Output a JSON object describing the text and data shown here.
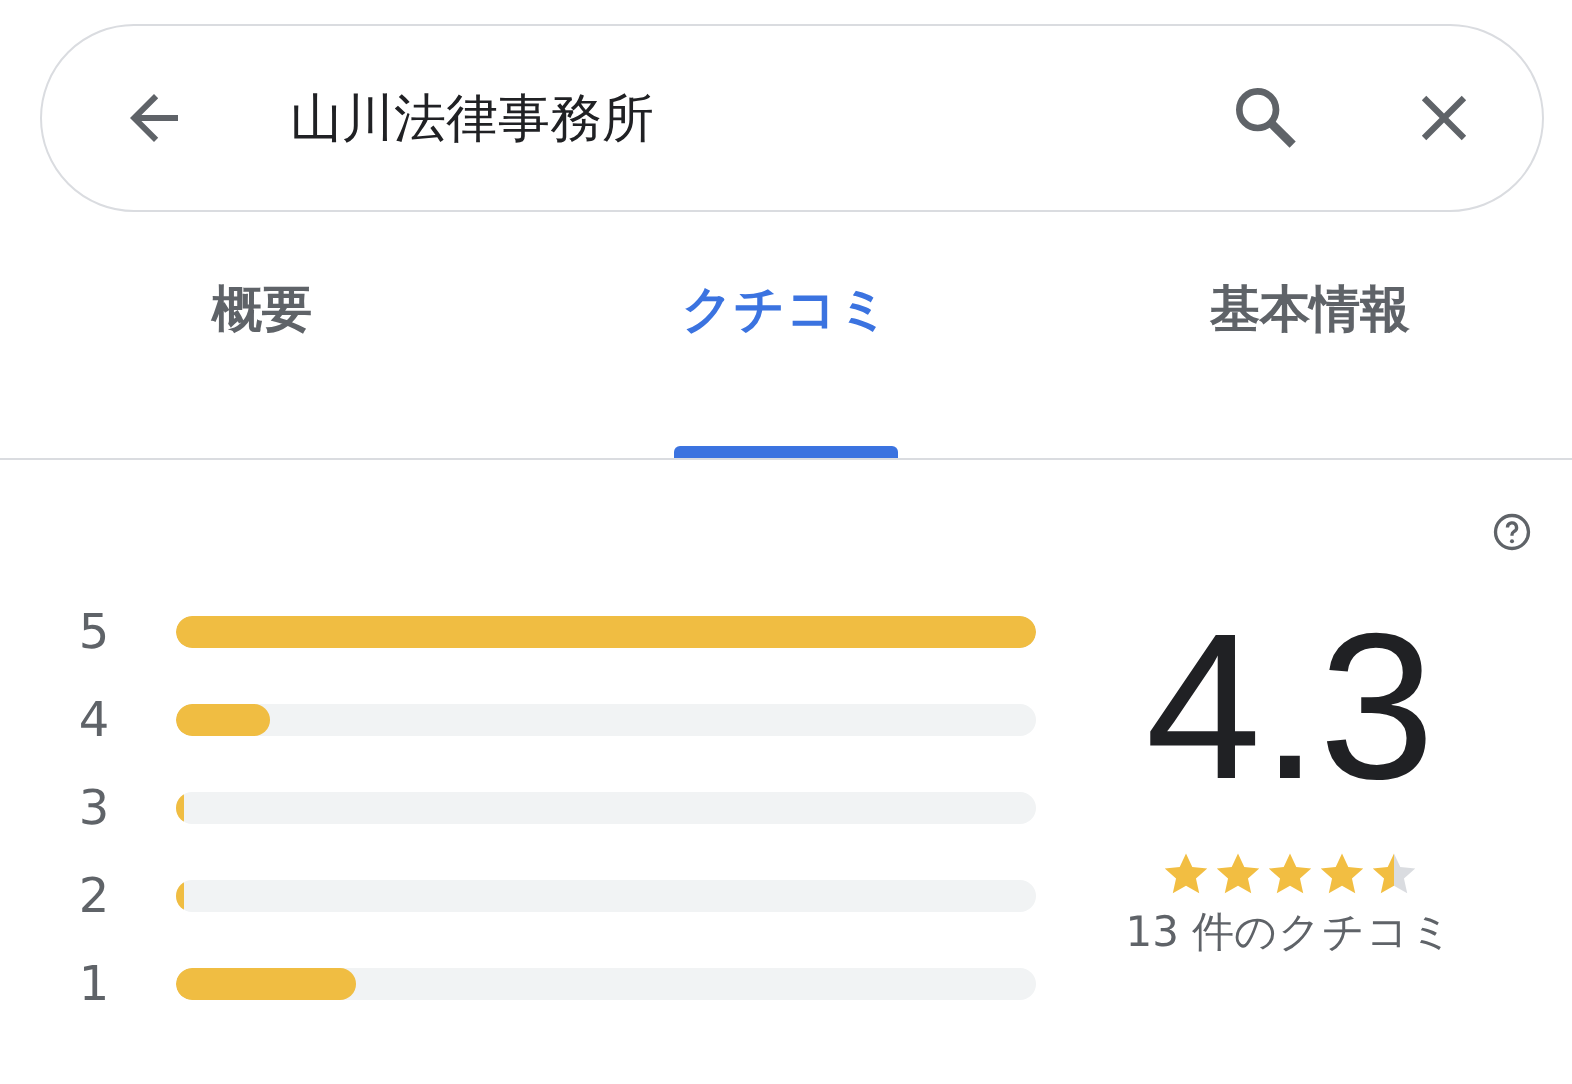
{
  "search": {
    "value": "山川法律事務所"
  },
  "tabs": [
    {
      "label": "概要",
      "selected": false
    },
    {
      "label": "クチコミ",
      "selected": true
    },
    {
      "label": "基本情報",
      "selected": false
    }
  ],
  "distribution": [
    {
      "label": "5",
      "level": 1.0
    },
    {
      "label": "4",
      "level": 0.11
    },
    {
      "label": "3",
      "level": 0.01
    },
    {
      "label": "2",
      "level": 0.01
    },
    {
      "label": "1",
      "level": 0.21
    }
  ],
  "summary": {
    "rating": "4.3",
    "stars": 4.5,
    "count": "13 件のクチコミ"
  }
}
